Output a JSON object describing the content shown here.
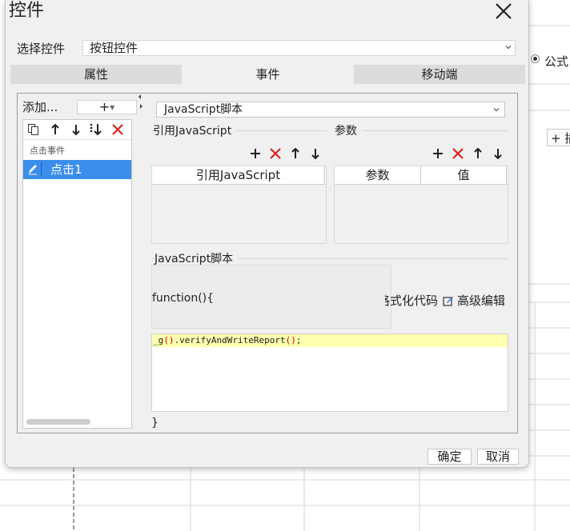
{
  "dialog": {
    "title": "控件",
    "select_label": "选择控件",
    "select_value": "按钮控件"
  },
  "tabs": [
    {
      "label": "属性"
    },
    {
      "label": "事件"
    },
    {
      "label": "移动端"
    }
  ],
  "active_tab": "事件",
  "events": {
    "add_label": "添加...",
    "add_button_symbol": "+",
    "group_label": "点击事件",
    "items": [
      {
        "label": "点击1",
        "selected": true
      }
    ]
  },
  "script_type": "JavaScript脚本",
  "ref_section": {
    "title": "引用JavaScript",
    "columns": [
      "引用JavaScript"
    ]
  },
  "param_section": {
    "title": "参数",
    "columns": [
      "参数",
      "值"
    ]
  },
  "script_section": {
    "title": "JavaScript脚本",
    "header_line": "function(){",
    "format_link": "格式化代码",
    "advanced_link": "高级编辑",
    "code_prefix": "_g",
    "code_mid": ".verifyAndWriteReport",
    "code_end": ";",
    "closing": "}"
  },
  "buttons": {
    "ok": "确定",
    "cancel": "取消"
  },
  "background": {
    "formula_label": "公式",
    "insert_label": "+ 插"
  },
  "colors": {
    "accent": "#3b8eea",
    "delete_red": "#e02020",
    "highlight": "#ffffb0",
    "paren_red": "#e00000"
  }
}
